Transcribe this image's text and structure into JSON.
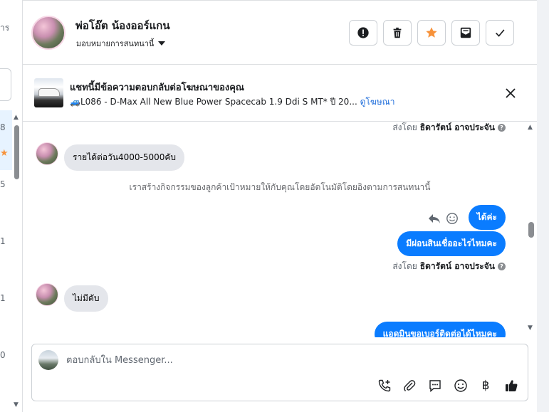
{
  "left_pane": {
    "fragments": [
      "าร",
      "8",
      "5",
      "1",
      "1",
      "0"
    ]
  },
  "header": {
    "contact_name": "พ่อโอ๊ต น้องออร์แกน",
    "assign_label": "มอบหมายการสนทนานี้",
    "actions": [
      {
        "label": "Mark as spam",
        "icon": "alert-icon"
      },
      {
        "label": "Delete",
        "icon": "trash-icon"
      },
      {
        "label": "Star",
        "icon": "star-icon",
        "color": "#f7923a"
      },
      {
        "label": "Mark as unread",
        "icon": "envelope-icon"
      },
      {
        "label": "Mark as done",
        "icon": "check-icon"
      }
    ]
  },
  "ad_banner": {
    "title": "แชทนี้มีข้อความตอบกลับต่อโฆษณาของคุณ",
    "subtitle": "🚙L086 - D-Max All New Blue Power Spacecab 1.9 Ddi S MT* ปี 20...",
    "link": "ดูโฆษณา"
  },
  "thread": {
    "sent_by_prefix": "ส่งโดย",
    "sent_by_name": "ธิดารัตน์ อาจประจัน",
    "messages": [
      {
        "direction": "in",
        "text": "รายได้ต่อวัน4000-5000คับ"
      },
      {
        "direction": "system",
        "text": "เราสร้างกิจกรรมของลูกค้าเป้าหมายให้กับคุณโดยอัตโนมัติโดยอิงตามการสนทนานี้"
      },
      {
        "direction": "out",
        "text": "ได้ค่ะ"
      },
      {
        "direction": "out",
        "text": "มีผ่อนสินเชื่ออะไรไหมคะ"
      },
      {
        "direction": "in",
        "text": "ไม่มีคับ"
      },
      {
        "direction": "out",
        "text": "แอดมินขอเบอร์ติดต่อได้ไหมคะ"
      }
    ]
  },
  "composer": {
    "placeholder": "ตอบกลับใน Messenger...",
    "tools": [
      "call-add-icon",
      "attach-icon",
      "saved-reply-icon",
      "emoji-icon",
      "baht-icon",
      "like-icon"
    ],
    "accent": "#0a7cff"
  }
}
